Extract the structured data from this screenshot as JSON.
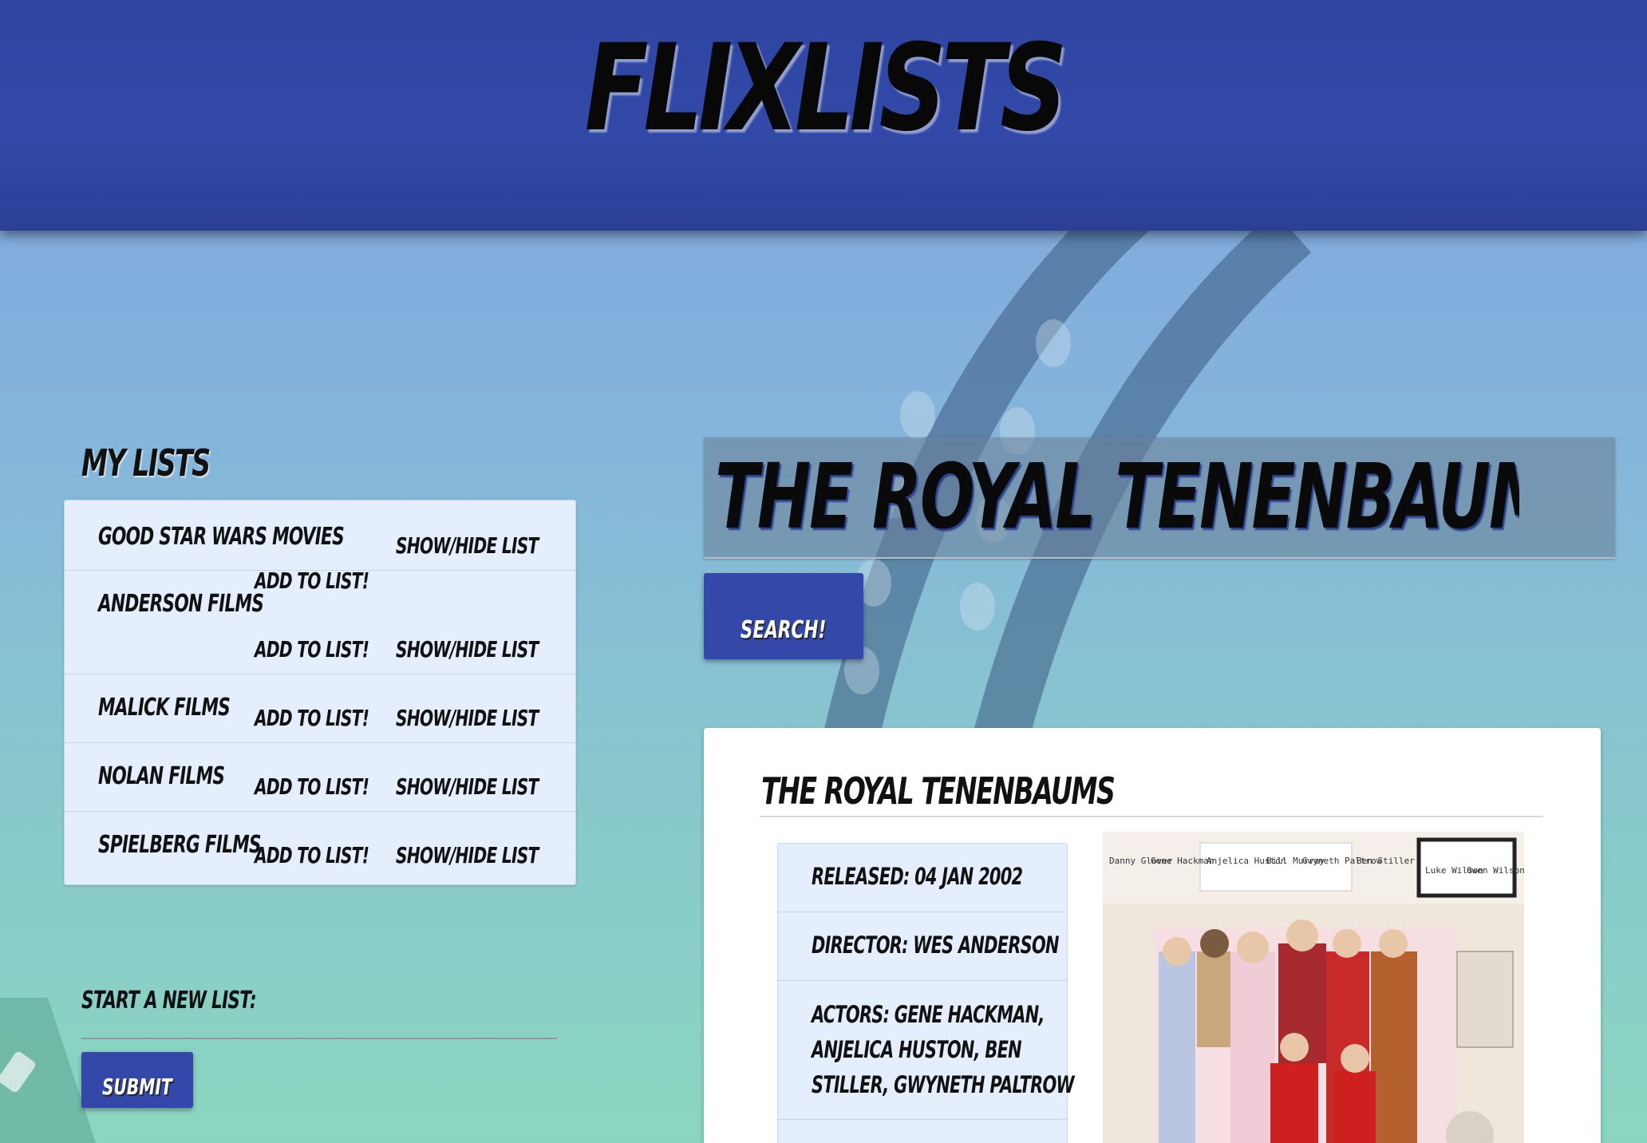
{
  "app": {
    "logo": "FLIXLISTS"
  },
  "sidebar": {
    "title": "MY LISTS",
    "lists": [
      {
        "name": "GOOD STAR WARS MOVIES",
        "add_label": "",
        "toggle_label": "SHOW/HIDE LIST"
      },
      {
        "name": "ANDERSON FILMS",
        "add_label_top": "ADD TO LIST!",
        "add_label": "ADD TO LIST!",
        "toggle_label": "SHOW/HIDE LIST"
      },
      {
        "name": "MALICK FILMS",
        "add_label": "ADD TO LIST!",
        "toggle_label": "SHOW/HIDE LIST"
      },
      {
        "name": "NOLAN FILMS",
        "add_label": "ADD TO LIST!",
        "toggle_label": "SHOW/HIDE LIST"
      },
      {
        "name": "SPIELBERG FILMS",
        "add_label": "ADD TO LIST!",
        "toggle_label": "SHOW/HIDE LIST"
      }
    ],
    "new_list": {
      "label": "START A NEW LIST:",
      "value": "",
      "submit_label": "SUBMIT"
    }
  },
  "search": {
    "value": "THE ROYAL TENENBAUMS",
    "button_label": "SEARCH!"
  },
  "result": {
    "title": "THE ROYAL TENENBAUMS",
    "released": "RELEASED: 04 JAN 2002",
    "director": "DIRECTOR: WES ANDERSON",
    "actors_lines": [
      "ACTORS: GENE HACKMAN,",
      "ANJELICA HUSTON, BEN",
      "STILLER, GWYNETH PALTROW"
    ],
    "poster": {
      "cast_names": [
        "Danny Glover",
        "Gene Hackman",
        "Anjelica Huston",
        "Bill Murray",
        "Gwyneth Paltrow",
        "Ben Stiller",
        "Luke Wilson",
        "Owen Wilson"
      ]
    }
  },
  "colors": {
    "header": "#3249a8",
    "button": "#3348a9",
    "panel": "#e5eefc"
  }
}
